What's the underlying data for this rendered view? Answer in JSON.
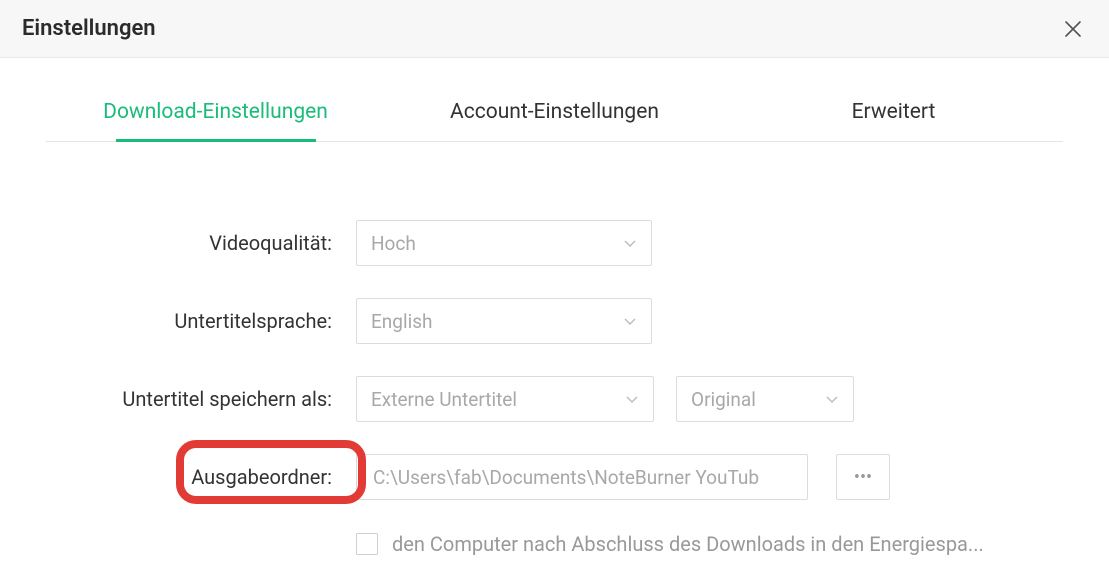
{
  "header": {
    "title": "Einstellungen"
  },
  "tabs": {
    "download": "Download-Einstellungen",
    "account": "Account-Einstellungen",
    "advanced": "Erweitert"
  },
  "form": {
    "video_quality_label": "Videoqualität:",
    "video_quality_value": "Hoch",
    "subtitle_lang_label": "Untertitelsprache:",
    "subtitle_lang_value": "English",
    "subtitle_save_label": "Untertitel speichern als:",
    "subtitle_save_value": "Externe Untertitel",
    "subtitle_save_secondary": "Original",
    "output_folder_label": "Ausgabeordner:",
    "output_folder_value": "C:\\Users\\fab\\Documents\\NoteBurner YouTub",
    "browse_icon": "•••",
    "sleep_checkbox_label": "den Computer nach Abschluss des Downloads in den Energiespa..."
  }
}
